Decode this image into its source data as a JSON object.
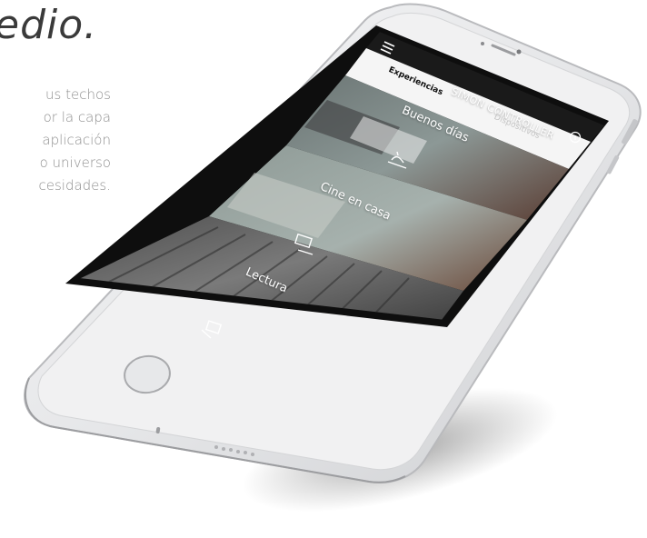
{
  "headline": "edio.",
  "body_lines": [
    "us techos",
    "or la capa",
    "aplicación",
    "o universo",
    "cesidades."
  ],
  "app": {
    "brand": "SIMON CONTROLLER",
    "tabs": [
      {
        "label": "Experiencias",
        "active": true
      },
      {
        "label": "Dispositivos",
        "active": false
      }
    ],
    "info_icon": "info-icon",
    "menu_icon": "menu-icon",
    "experiences": [
      {
        "label": "Buenos días",
        "icon": "sunrise-icon"
      },
      {
        "label": "Cine en casa",
        "icon": "tv-icon"
      },
      {
        "label": "Lectura",
        "icon": "book-icon"
      }
    ]
  },
  "colors": {
    "phone_body": "#e9e9ea",
    "phone_edge": "#bfc0c2",
    "screen_bezel": "#0d0d0d",
    "app_header": "#1a1a1a",
    "tab_bar": "#f4f4f4",
    "card1": "#6d7b7a",
    "card2": "#8a9793",
    "card3": "#5a5a5a"
  }
}
